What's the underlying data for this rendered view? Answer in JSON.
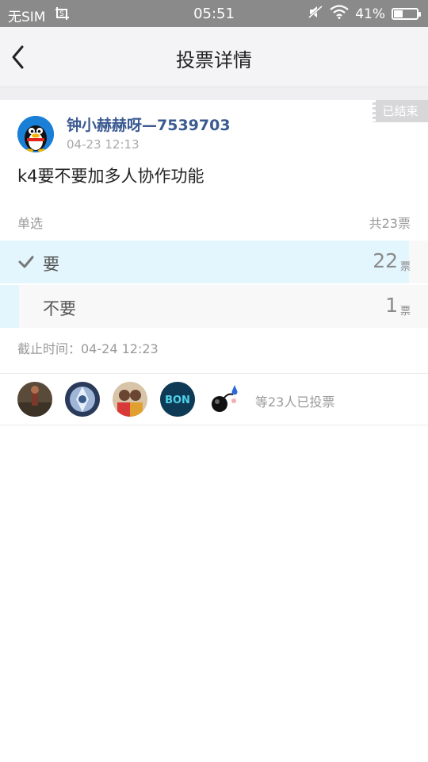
{
  "status_bar": {
    "carrier": "无SIM",
    "time": "05:51",
    "battery": "41%",
    "battery_level": 0.41
  },
  "header": {
    "title": "投票详情",
    "back_icon": "chevron-left-icon"
  },
  "post": {
    "status_tag": "已结束",
    "author": "钟小赫赫呀—7539703",
    "time": "04-23 12:13",
    "question": "k4要不要加多人协作功能",
    "vote_type": "单选",
    "total": "共23票",
    "options": [
      {
        "label": "要",
        "count": "22",
        "unit": "票",
        "fraction": 0.956,
        "selected": true
      },
      {
        "label": "不要",
        "count": "1",
        "unit": "票",
        "fraction": 0.044,
        "selected": false
      }
    ],
    "deadline": "截止时间：04-24 12:23"
  },
  "voters": {
    "summary": "等23人已投票",
    "avatar_colors": [
      "#5a4a3a",
      "#2a3a5a",
      "#c48a5a",
      "#0f3a55",
      "#ffffff"
    ]
  },
  "colors": {
    "accent_bar": "#e3f5fd",
    "author_name": "#3b5a92",
    "status_bar": "#8a8a8a"
  }
}
